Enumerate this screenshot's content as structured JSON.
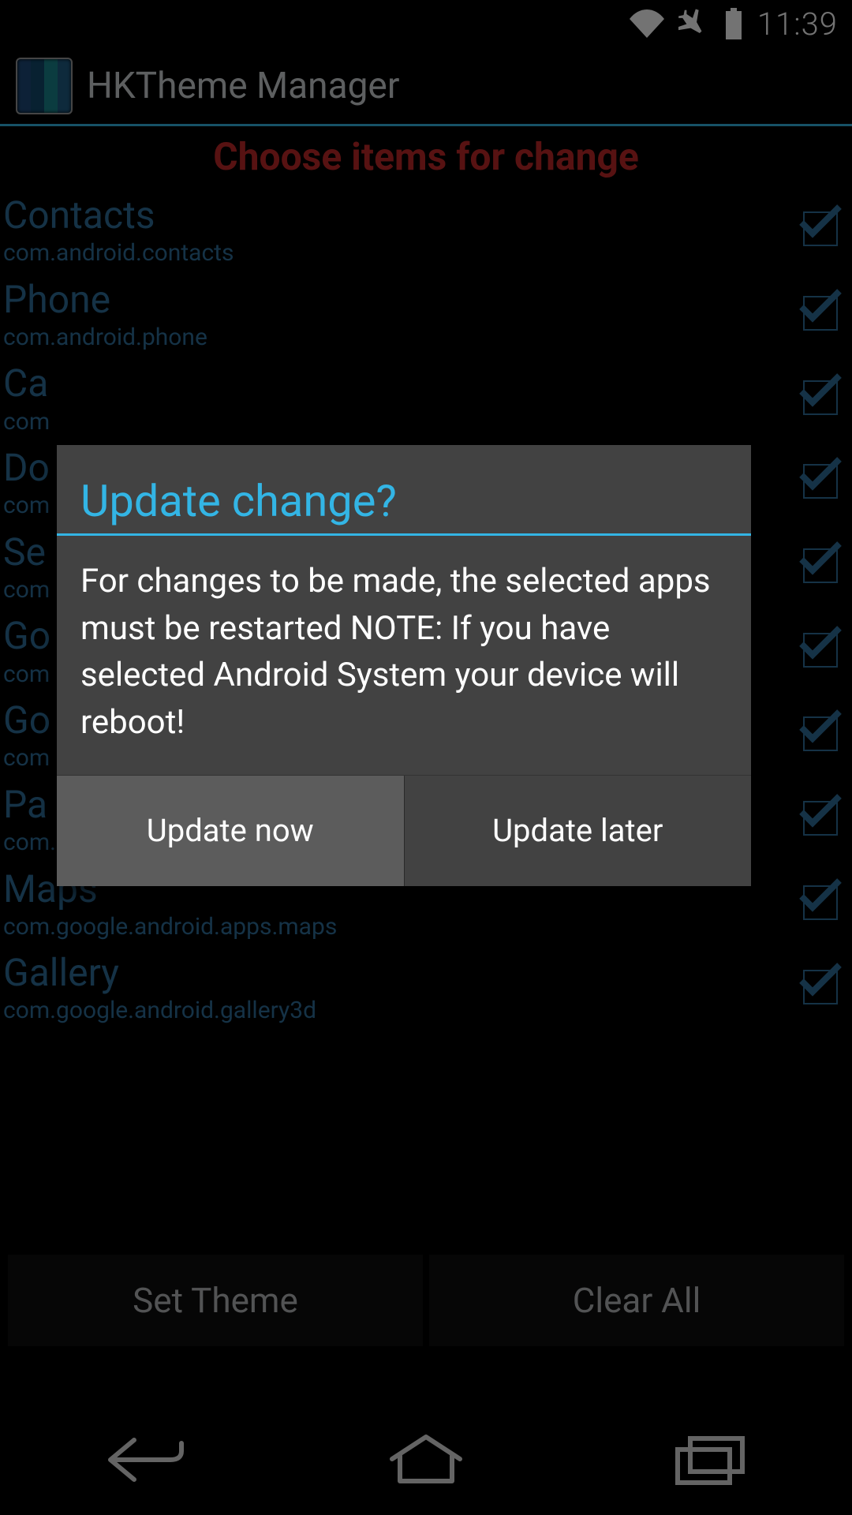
{
  "status": {
    "time": "11:39"
  },
  "app": {
    "title": "HKTheme Manager"
  },
  "list": {
    "header": "Choose items for change",
    "items": [
      {
        "title": "Contacts",
        "sub": "com.android.contacts",
        "checked": true
      },
      {
        "title": "Phone",
        "sub": "com.android.phone",
        "checked": true
      },
      {
        "title": "Ca",
        "sub": "com",
        "checked": true
      },
      {
        "title": "Do",
        "sub": "com",
        "checked": true
      },
      {
        "title": "Se",
        "sub": "com",
        "checked": true
      },
      {
        "title": "Go",
        "sub": "com",
        "checked": true
      },
      {
        "title": "Go",
        "sub": "com",
        "checked": true
      },
      {
        "title": "Pa",
        "sub": "com.android.packageinstaller",
        "checked": true
      },
      {
        "title": "Maps",
        "sub": "com.google.android.apps.maps",
        "checked": true
      },
      {
        "title": "Gallery",
        "sub": "com.google.android.gallery3d",
        "checked": true
      }
    ]
  },
  "buttons": {
    "set_theme": "Set Theme",
    "clear_all": "Clear All"
  },
  "dialog": {
    "title": "Update change?",
    "body": "For changes to be made, the selected apps must be restarted NOTE: If you have selected Android System your device will reboot!",
    "primary": "Update now",
    "secondary": "Update later"
  }
}
